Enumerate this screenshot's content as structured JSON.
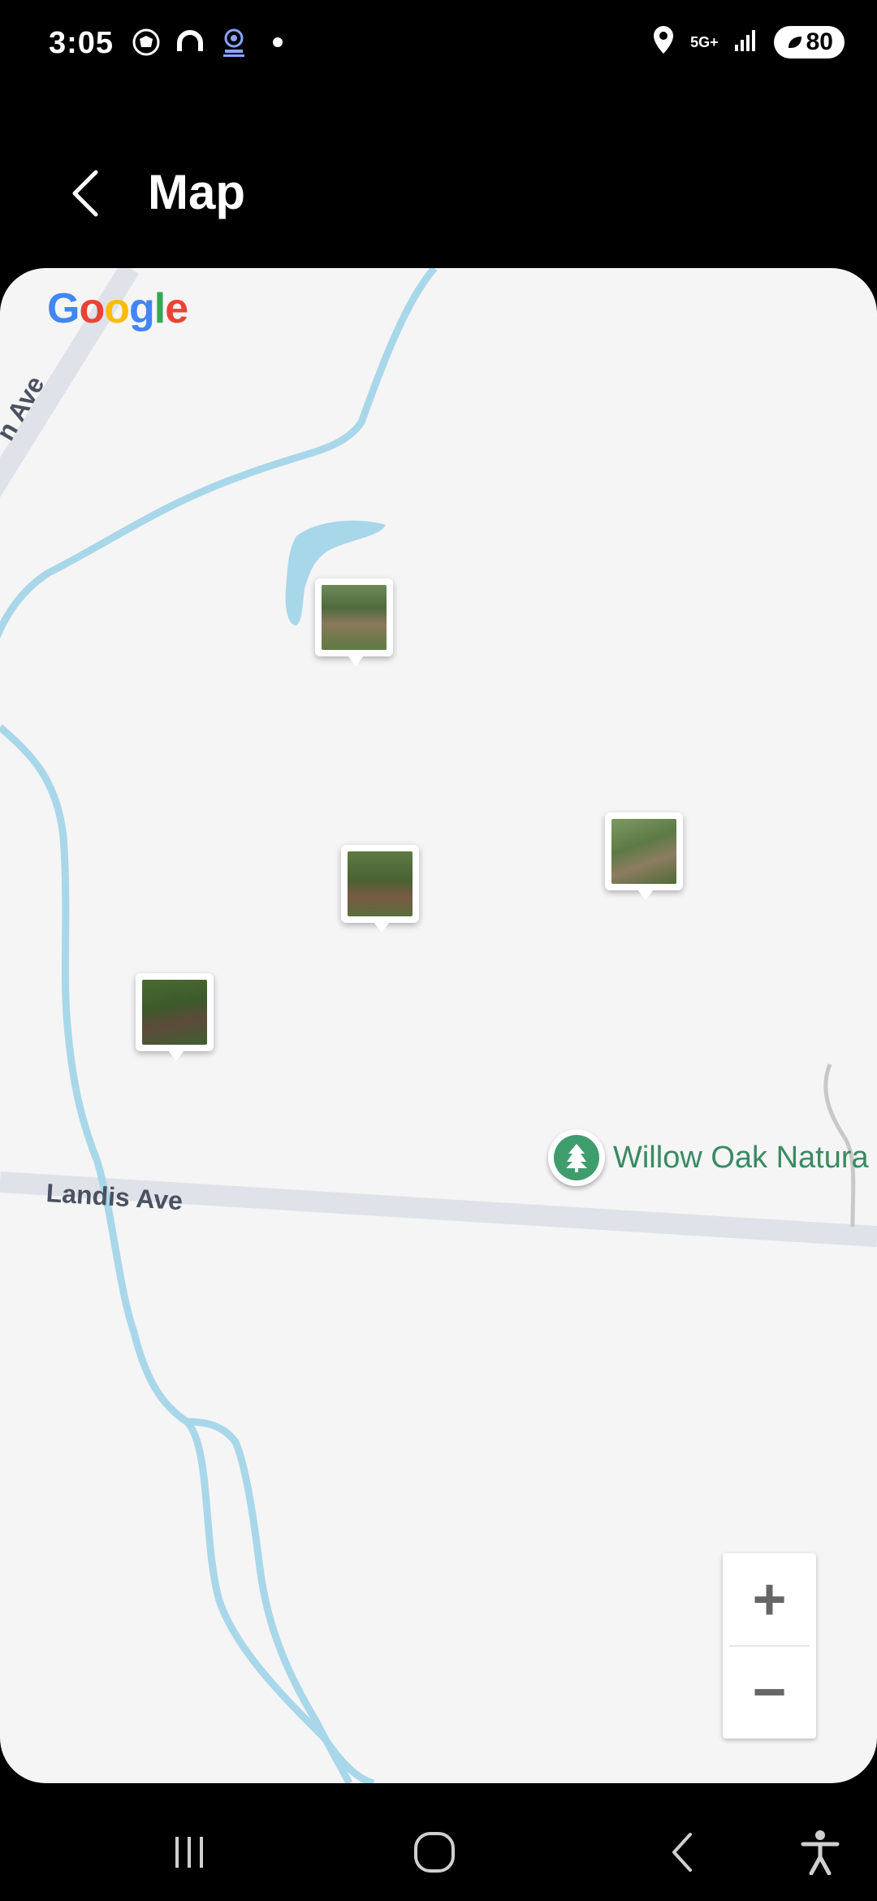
{
  "status_bar": {
    "time": "3:05",
    "network": "5G+",
    "battery": "80",
    "left_icons": [
      "photo-notification-icon",
      "headphones-icon",
      "vpn-icon",
      "dot-icon"
    ],
    "right_icons": [
      "location-icon",
      "signal-icon",
      "battery-icon"
    ]
  },
  "app_bar": {
    "title": "Map",
    "back_icon": "chevron-left-icon"
  },
  "map": {
    "provider_logo": "Google",
    "streets": {
      "landis": "Landis Ave",
      "diagonal": "n Ave"
    },
    "poi": {
      "label": "Willow Oak Natura",
      "icon": "tree-icon"
    },
    "photo_markers": [
      {
        "name": "photo-marker-1",
        "description": "trail photo"
      },
      {
        "name": "photo-marker-2",
        "description": "trail photo"
      },
      {
        "name": "photo-marker-3",
        "description": "trail photo"
      },
      {
        "name": "photo-marker-4",
        "description": "trail photo"
      }
    ],
    "zoom": {
      "in": "+",
      "out": "−"
    },
    "colors": {
      "background": "#f5f5f6",
      "water": "#a9d7ea",
      "road": "#dfe2e8",
      "poi": "#3f9d6d"
    }
  },
  "nav_bar": {
    "icons": [
      "recent-apps-icon",
      "home-icon",
      "back-icon",
      "accessibility-icon"
    ]
  }
}
